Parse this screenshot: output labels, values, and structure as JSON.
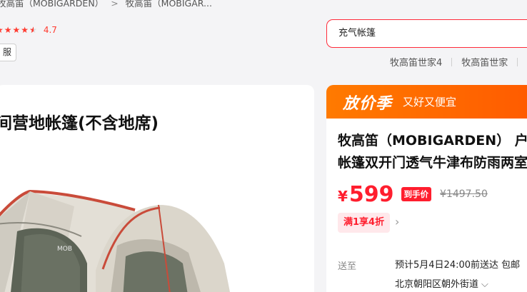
{
  "breadcrumb": {
    "items": [
      "牧高笛（MOBIGARDEN）",
      "牧高笛（MOBIGAR..."
    ],
    "separator": ">"
  },
  "rating": {
    "value": "4.7",
    "stars": 4.5
  },
  "service_tag": "服",
  "search": {
    "value": "充气帐篷"
  },
  "search_links": [
    "牧高笛世家4",
    "牧高笛世家"
  ],
  "gallery": {
    "title": "间营地帐篷(不含地席)",
    "subtitle": ")"
  },
  "promo": {
    "main": "放价季",
    "sub": "又好又便宜"
  },
  "product": {
    "title": "牧高笛（MOBIGARDEN） 户外帐篷双开门透气牛津布防雨两室一",
    "currency": "¥",
    "price": "599",
    "price_tag": "到手价",
    "original_price": "¥1497.50",
    "coupon": "满1享4折",
    "coupon_arrow": "›"
  },
  "shipping": {
    "label": "送至",
    "eta": "预计5月4日24:00前送达   包邮",
    "address": "北京朝阳区朝外街道",
    "address_chevron": "⌵"
  },
  "colors": {
    "accent": "#ff1e2e",
    "promo": "#ff6a00"
  }
}
